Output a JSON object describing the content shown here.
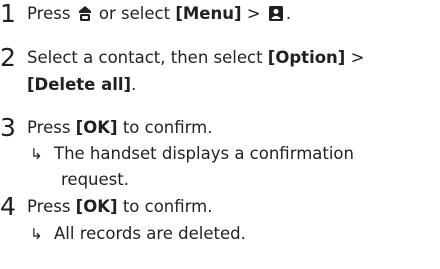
{
  "steps": [
    {
      "number": "1",
      "line1": {
        "pre": "Press ",
        "mid": " or select ",
        "menu": "[Menu]",
        "sep": " > ",
        "end": "."
      },
      "icons": [
        "home-phone-icon",
        "phonebook-icon"
      ]
    },
    {
      "number": "2",
      "line1": {
        "pre": "Select a contact, then select ",
        "option": "[Option]",
        "sep": " >"
      },
      "line2": {
        "delete": "[Delete all]",
        "end": "."
      }
    },
    {
      "number": "3",
      "line1": {
        "pre": "Press ",
        "ok": "[OK]",
        "end": " to confirm."
      },
      "result": {
        "arrow": "↳",
        "line1": "The handset displays a confirmation",
        "line2": "request."
      }
    },
    {
      "number": "4",
      "line1": {
        "pre": "Press ",
        "ok": "[OK]",
        "end": " to confirm."
      },
      "result": {
        "arrow": "↳",
        "line1": "All records are deleted."
      }
    }
  ]
}
